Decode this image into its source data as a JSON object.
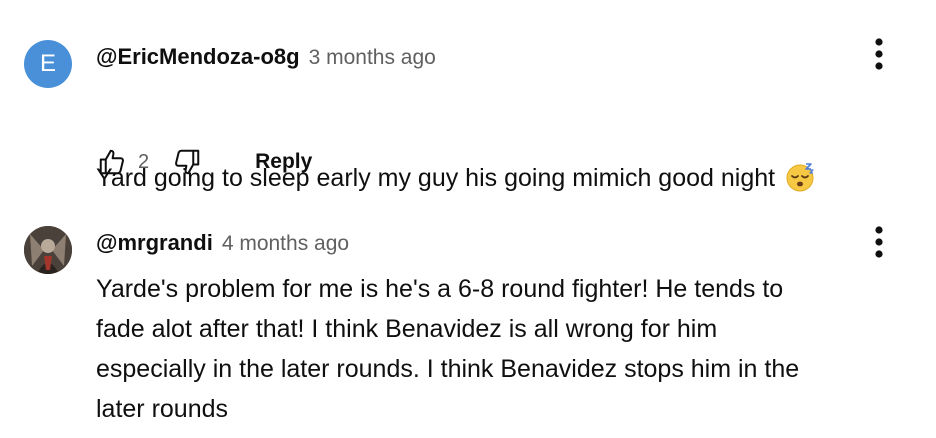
{
  "comments": [
    {
      "avatar_letter": "E",
      "author": "@EricMendoza-o8g",
      "timestamp": "3 months ago",
      "text": "Yard going to sleep early my guy his going mimich good night",
      "emoji": "sleeping-face-emoji",
      "likes": "2",
      "reply_label": "Reply",
      "avatar_color": "#4a90d9"
    },
    {
      "author": "@mrgrandi",
      "timestamp": "4 months ago",
      "text": "Yarde's problem for me is he's a 6-8 round fighter! He tends to\nfade alot after that!  I think Benavidez is all wrong for him\nespecially in the later rounds. I think Benavidez stops him in the\nlater rounds"
    }
  ],
  "colors": {
    "primary_text": "#0f0f0f",
    "secondary_text": "#606060",
    "background": "#ffffff"
  }
}
